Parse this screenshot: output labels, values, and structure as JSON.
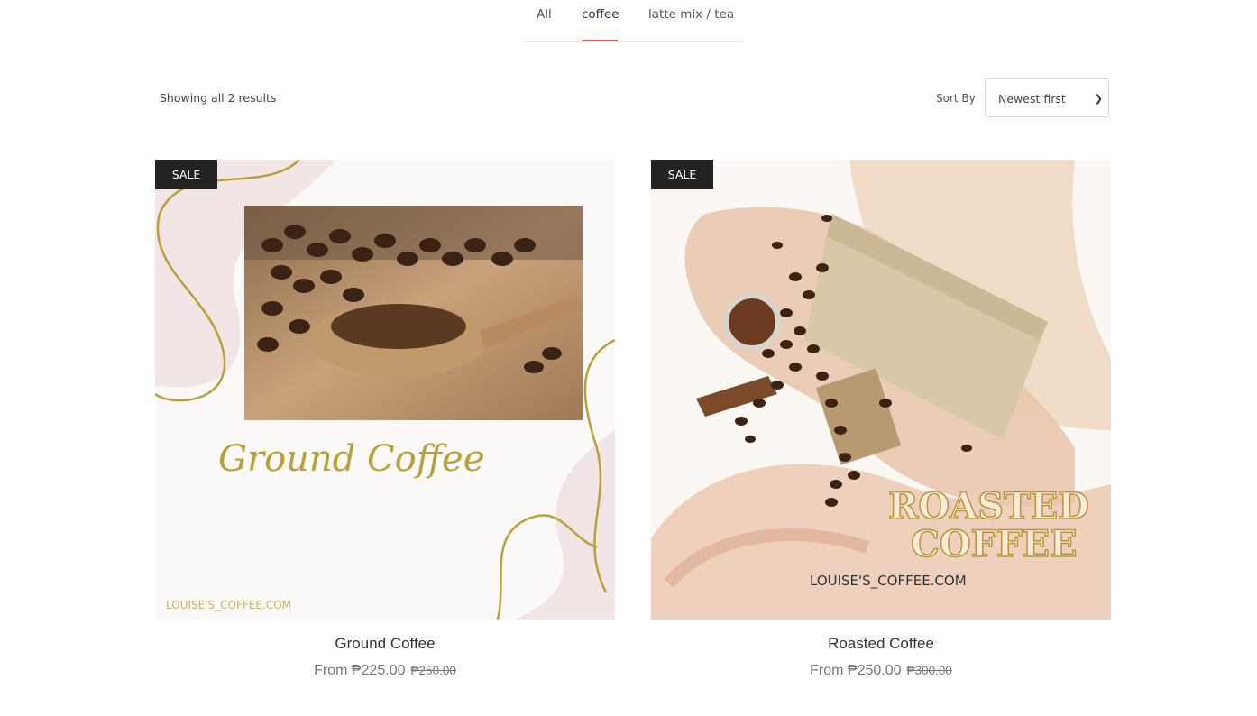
{
  "tabs": [
    {
      "label": "All"
    },
    {
      "label": "coffee"
    },
    {
      "label": "latte mix / tea"
    }
  ],
  "toolbar": {
    "results_text": "Showing all 2 results",
    "sort_label": "Sort By",
    "sort_value": "Newest first"
  },
  "products": [
    {
      "badge": "SALE",
      "image_title": "Ground Coffee",
      "image_footer": "LOUISE'S_COFFEE.COM",
      "name": "Ground Coffee",
      "price": "From ₱225.00",
      "old_price": "₱250.00"
    },
    {
      "badge": "SALE",
      "image_title_line1": "ROASTED",
      "image_title_line2": "COFFEE",
      "image_footer": "LOUISE'S_COFFEE.COM",
      "name": "Roasted Coffee",
      "price": "From ₱250.00",
      "old_price": "₱300.00"
    }
  ],
  "colors": {
    "accent": "#d9534f",
    "badge": "#222222",
    "gold": "#b8a03a"
  }
}
